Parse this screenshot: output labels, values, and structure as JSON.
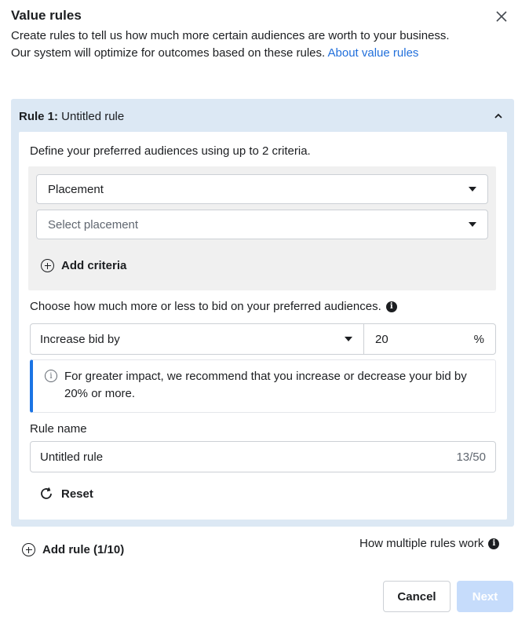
{
  "dialog": {
    "title": "Value rules",
    "description": "Create rules to tell us how much more certain audiences are worth to your business. Our system will optimize for outcomes based on these rules. ",
    "link_text": "About value rules"
  },
  "rule": {
    "number_label": "Rule 1:",
    "name_display": " Untitled rule",
    "define_text": "Define your preferred audiences using up to 2 criteria.",
    "criteria_select_value": "Placement",
    "placement_placeholder": "Select placement",
    "add_criteria_label": "Add criteria",
    "choose_text": "Choose how much more or less to bid on your preferred audiences.",
    "bid_select_value": "Increase bid by",
    "bid_amount": "20",
    "bid_unit": "%",
    "notice_text": "For greater impact, we recommend that you increase or decrease your bid by 20% or more.",
    "rule_name_label": "Rule name",
    "rule_name_value": "Untitled rule",
    "rule_name_counter": "13/50",
    "reset_label": "Reset"
  },
  "footer": {
    "add_rule_label": "Add rule (1/10)",
    "how_rules_label": "How multiple rules work",
    "cancel_label": "Cancel",
    "next_label": "Next"
  },
  "icons": {
    "close": "close-icon",
    "collapse": "chevron-up-icon",
    "info": "info-icon",
    "add": "plus-circle-icon",
    "reset": "refresh-icon"
  },
  "colors": {
    "accent": "#216fdb",
    "card_bg": "#dce8f4",
    "notice_border": "#1b74e4",
    "next_disabled": "#c6dcfb"
  }
}
